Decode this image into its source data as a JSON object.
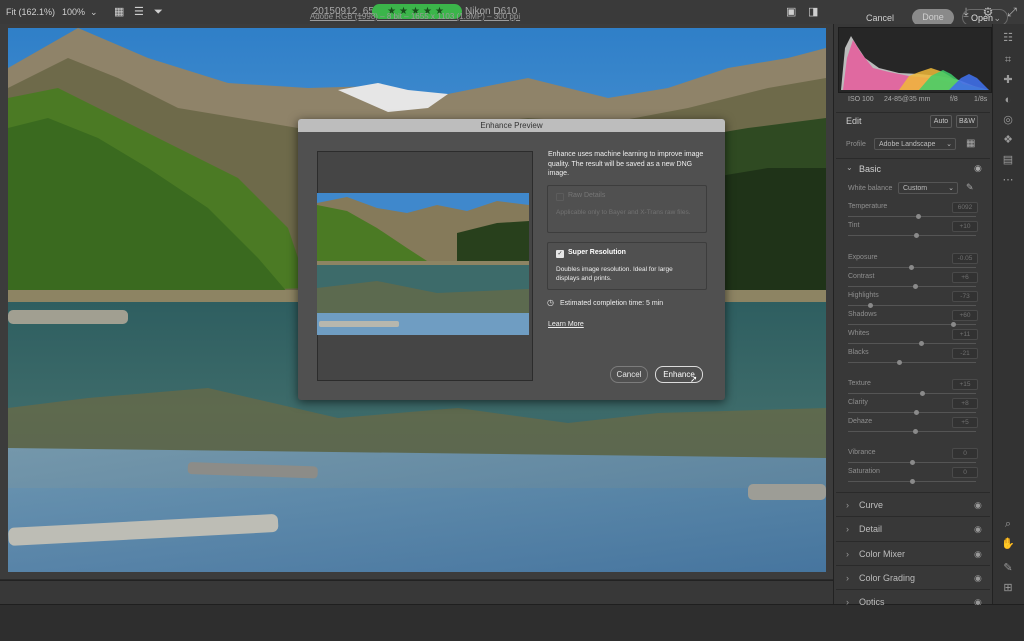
{
  "window": {
    "title": "20150912_6555-HDR-Pano.dng  -  Nikon D610"
  },
  "titlebar_icons": [
    "save-icon",
    "gear-icon"
  ],
  "bottom_bar": {
    "fit_label": "Fit (162.1%)",
    "zoom_label": "100%",
    "rating_stars": "★★★★★",
    "rating_value": 5
  },
  "footer": {
    "info": "Adobe RGB (1998) – 8 bit – 1655 x 1103 (1.8MP) – 300 ppi",
    "cancel": "Cancel",
    "done": "Done",
    "open": "Open"
  },
  "panel": {
    "exif": [
      "ISO 100",
      "24-85@35 mm",
      "f/8",
      "1/8s"
    ],
    "edit": {
      "label": "Edit",
      "auto": "Auto",
      "bw": "B&W",
      "profile_label": "Profile",
      "profile_value": "Adobe Landscape"
    },
    "basic": {
      "label": "Basic",
      "white_balance_label": "White balance",
      "white_balance_value": "Custom",
      "sliders": [
        {
          "label": "Temperature",
          "value": "6092",
          "pos": 0.55
        },
        {
          "label": "Tint",
          "value": "+10",
          "pos": 0.53
        },
        {
          "label": "Exposure",
          "value": "-0.05",
          "pos": 0.49
        },
        {
          "label": "Contrast",
          "value": "+6",
          "pos": 0.52
        },
        {
          "label": "Highlights",
          "value": "-73",
          "pos": 0.17
        },
        {
          "label": "Shadows",
          "value": "+60",
          "pos": 0.82
        },
        {
          "label": "Whites",
          "value": "+11",
          "pos": 0.57
        },
        {
          "label": "Blacks",
          "value": "-21",
          "pos": 0.4
        },
        {
          "label": "Texture",
          "value": "+15",
          "pos": 0.58
        },
        {
          "label": "Clarity",
          "value": "+8",
          "pos": 0.53
        },
        {
          "label": "Dehaze",
          "value": "+5",
          "pos": 0.52
        },
        {
          "label": "Vibrance",
          "value": "0",
          "pos": 0.5
        },
        {
          "label": "Saturation",
          "value": "0",
          "pos": 0.5
        }
      ]
    },
    "sections": [
      "Curve",
      "Detail",
      "Color Mixer",
      "Color Grading",
      "Optics"
    ]
  },
  "tools": [
    "edit-sliders-icon",
    "crop-icon",
    "healing-icon",
    "mask-icon",
    "redeye-icon",
    "presets-icon",
    "snapshots-icon",
    "more-icon"
  ],
  "dialog": {
    "title": "Enhance Preview",
    "description": "Enhance uses machine learning to improve image quality. The result will be saved as a new DNG image.",
    "raw_details": {
      "label": "Raw Details",
      "desc": "Applicable only to Bayer and X-Trans raw files.",
      "checked": false
    },
    "super_resolution": {
      "label": "Super Resolution",
      "desc": "Doubles image resolution. Ideal for large displays and prints.",
      "checked": true
    },
    "estimate": "Estimated completion time: 5 min",
    "learn_more": "Learn More",
    "cancel": "Cancel",
    "enhance": "Enhance"
  },
  "colors": {
    "accent_green": "#3bb54a",
    "panel_bg": "#383838",
    "dialog_bg": "#505050"
  }
}
